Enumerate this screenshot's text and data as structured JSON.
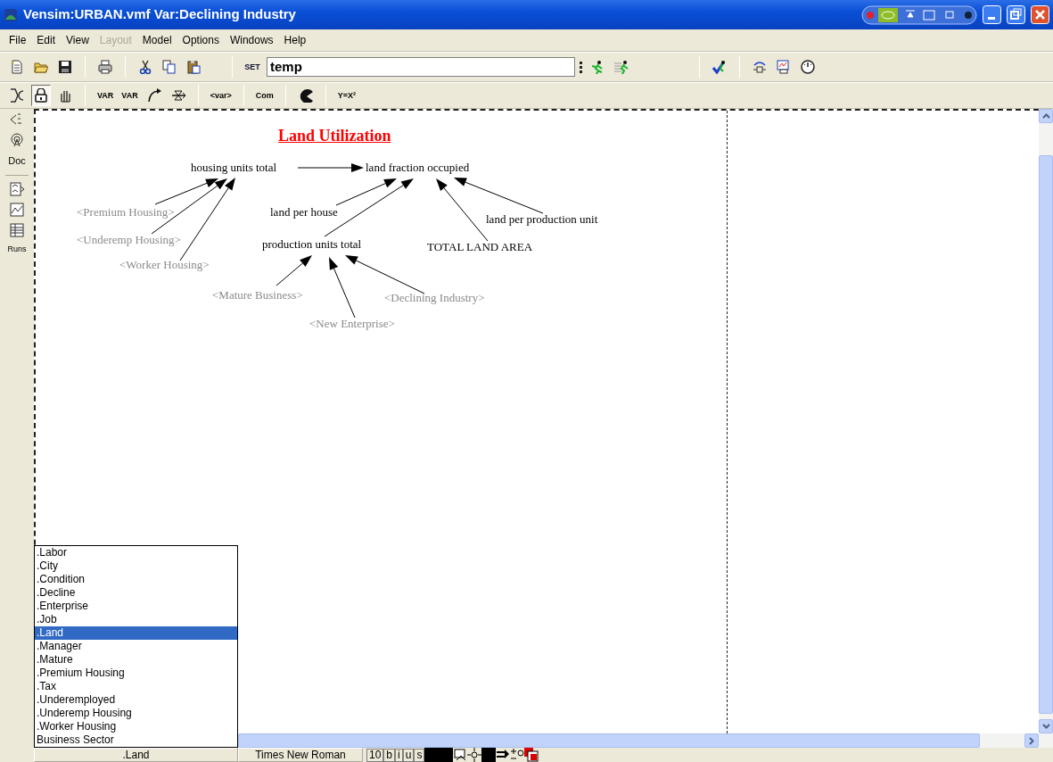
{
  "window": {
    "title": "Vensim:URBAN.vmf Var:Declining Industry"
  },
  "menu": [
    {
      "label": "File",
      "disabled": false
    },
    {
      "label": "Edit",
      "disabled": false
    },
    {
      "label": "View",
      "disabled": false
    },
    {
      "label": "Layout",
      "disabled": true
    },
    {
      "label": "Model",
      "disabled": false
    },
    {
      "label": "Options",
      "disabled": false
    },
    {
      "label": "Windows",
      "disabled": false
    },
    {
      "label": "Help",
      "disabled": false
    }
  ],
  "main_toolbar": [
    {
      "kind": "icon"
    },
    {
      "kind": "icon"
    },
    {
      "kind": "icon"
    },
    {
      "kind": "separator"
    },
    {
      "kind": "icon"
    },
    {
      "kind": "separator"
    },
    {
      "kind": "icon"
    },
    {
      "kind": "icon"
    },
    {
      "kind": "icon"
    },
    {
      "kind": "separator"
    },
    {
      "kind": "labeled",
      "label": "SET"
    },
    {
      "kind": "field",
      "value": "temp"
    },
    {
      "kind": "icon"
    },
    {
      "kind": "icon"
    },
    {
      "kind": "separator"
    },
    {
      "kind": "icon"
    },
    {
      "kind": "separator"
    },
    {
      "kind": "icon"
    },
    {
      "kind": "icon"
    },
    {
      "kind": "icon"
    }
  ],
  "sketch_toolbar": [
    {
      "kind": "icon",
      "selected": false
    },
    {
      "kind": "icon",
      "selected": true
    },
    {
      "kind": "icon",
      "selected": false
    },
    {
      "kind": "separator"
    },
    {
      "kind": "labeled",
      "label": "VAR",
      "selected": false
    },
    {
      "kind": "labeled",
      "label": "VAR",
      "selected": false
    },
    {
      "kind": "icon",
      "selected": false
    },
    {
      "kind": "icon",
      "selected": false
    },
    {
      "kind": "separator"
    },
    {
      "kind": "labeled",
      "label": "<var>",
      "selected": false
    },
    {
      "kind": "separator"
    },
    {
      "kind": "labeled",
      "label": "Com",
      "selected": false
    },
    {
      "kind": "separator"
    },
    {
      "kind": "icon",
      "selected": false
    },
    {
      "kind": "separator"
    },
    {
      "kind": "labeled",
      "label": "Y=X²",
      "selected": false
    }
  ],
  "analysis_tools": [
    {
      "kind": "icon"
    },
    {
      "kind": "icon"
    },
    {
      "kind": "text",
      "label": "Doc"
    },
    {
      "kind": "separator"
    },
    {
      "kind": "icon"
    },
    {
      "kind": "icon"
    },
    {
      "kind": "icon"
    },
    {
      "kind": "text",
      "label": "Runs"
    }
  ],
  "diagram": {
    "title": "Land Utilization",
    "nodes": [
      {
        "text": "housing units total",
        "kind": "variable"
      },
      {
        "text": "land fraction occupied",
        "kind": "variable"
      },
      {
        "text": "<Premium Housing>",
        "kind": "shadow"
      },
      {
        "text": "<Underemp Housing>",
        "kind": "shadow"
      },
      {
        "text": "<Worker Housing>",
        "kind": "shadow"
      },
      {
        "text": "land per house",
        "kind": "variable"
      },
      {
        "text": "production units total",
        "kind": "variable"
      },
      {
        "text": "TOTAL LAND AREA",
        "kind": "variable"
      },
      {
        "text": "land per production unit",
        "kind": "variable"
      },
      {
        "text": "<Mature Business>",
        "kind": "shadow"
      },
      {
        "text": "<New Enterprise>",
        "kind": "shadow"
      },
      {
        "text": "<Declining Industry>",
        "kind": "shadow"
      }
    ]
  },
  "view_list": [
    {
      "label": ".Labor",
      "selected": false
    },
    {
      "label": ".City",
      "selected": false
    },
    {
      "label": ".Condition",
      "selected": false
    },
    {
      "label": ".Decline",
      "selected": false
    },
    {
      "label": ".Enterprise",
      "selected": false
    },
    {
      "label": ".Job",
      "selected": false
    },
    {
      "label": ".Land",
      "selected": true
    },
    {
      "label": ".Manager",
      "selected": false
    },
    {
      "label": ".Mature",
      "selected": false
    },
    {
      "label": ".Premium Housing",
      "selected": false
    },
    {
      "label": ".Tax",
      "selected": false
    },
    {
      "label": ".Underemployed",
      "selected": false
    },
    {
      "label": ".Underemp Housing",
      "selected": false
    },
    {
      "label": ".Worker Housing",
      "selected": false
    },
    {
      "label": "Business Sector",
      "selected": false
    }
  ],
  "status_bar": {
    "view": ".Land",
    "font": "Times New Roman",
    "size": "10",
    "styles": [
      "b",
      "i",
      "u",
      "s"
    ]
  }
}
